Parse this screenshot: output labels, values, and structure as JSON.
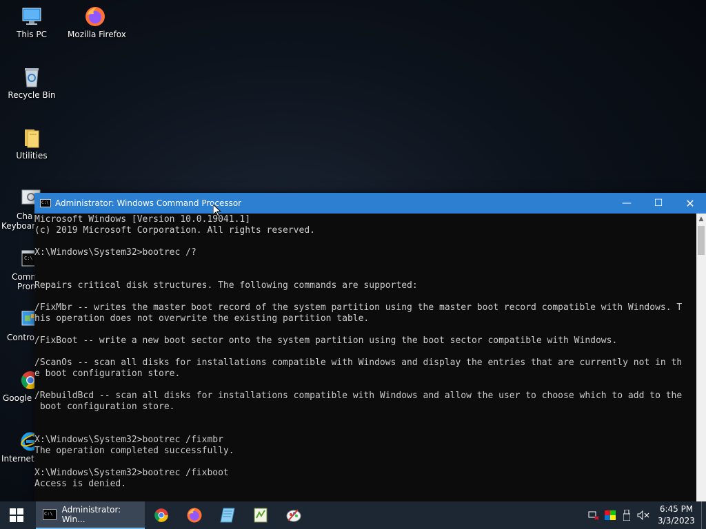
{
  "desktop": {
    "icons": [
      {
        "label": "This PC",
        "icon": "this-pc-icon"
      },
      {
        "label": "Mozilla Firefox",
        "icon": "firefox-icon"
      },
      {
        "label": "Recycle Bin",
        "icon": "recycle-bin-icon"
      },
      {
        "label": "Utilities",
        "icon": "folder-icon"
      },
      {
        "label": "Cha",
        "label2": "Keyboard",
        "icon": "keyboard-settings-icon"
      },
      {
        "label": "Comm",
        "label2": "Prom",
        "icon": "command-prompt-icon"
      },
      {
        "label": "Control",
        "icon": "control-panel-icon"
      },
      {
        "label": "Google C",
        "icon": "chrome-icon"
      },
      {
        "label": "Internet E",
        "icon": "internet-explorer-icon"
      }
    ]
  },
  "cmd_window": {
    "title": "Administrator: Windows Command Processor",
    "icon": "cmd-icon",
    "title_icon_text": "C:\\",
    "controls": {
      "minimize": "—",
      "maximize": "☐",
      "close": "✕"
    },
    "scroll_up": "▲",
    "output": "Microsoft Windows [Version 10.0.19041.1]\n(c) 2019 Microsoft Corporation. All rights reserved.\n\nX:\\Windows\\System32>bootrec /?\n\n\nRepairs critical disk structures. The following commands are supported:\n\n/FixMbr -- writes the master boot record of the system partition using the master boot record compatible with Windows. T\nhis operation does not overwrite the existing partition table.\n\n/FixBoot -- write a new boot sector onto the system partition using the boot sector compatible with Windows.\n\n/ScanOs -- scan all disks for installations compatible with Windows and display the entries that are currently not in th\ne boot configuration store.\n\n/RebuildBcd -- scan all disks for installations compatible with Windows and allow the user to choose which to add to the\n boot configuration store.\n\n\nX:\\Windows\\System32>bootrec /fixmbr\nThe operation completed successfully.\n\nX:\\Windows\\System32>bootrec /fixboot\nAccess is denied."
  },
  "taskbar": {
    "active_task_label": "Administrator: Win...",
    "task_icon_text": "C:\\",
    "apps": [
      "chrome-icon",
      "firefox-icon",
      "notepad-icon",
      "notepad-plus-icon",
      "paint-icon"
    ],
    "tray_icons": [
      "network-icon",
      "color-icon",
      "usb-icon",
      "volume-muted-icon"
    ],
    "clock_time": "6:45 PM",
    "clock_date": "3/3/2023"
  },
  "colors": {
    "titlebar": "#2d7fd1",
    "console_bg": "#0c0c0c",
    "console_text": "#cccccc",
    "taskbar": "#1d2734"
  }
}
